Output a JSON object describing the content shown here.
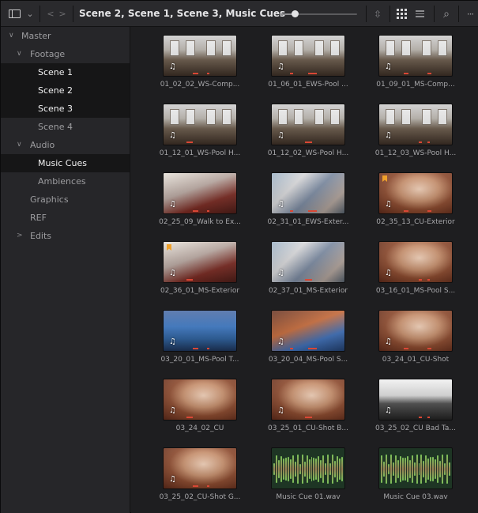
{
  "toolbar": {
    "title": "Scene 2, Scene 1, Scene 3, Music Cues",
    "icons": [
      "sidebar-toggle-icon",
      "chevron-down-icon",
      "back-icon",
      "forward-icon",
      "sort-icon",
      "grid-view-icon",
      "list-view-icon",
      "search-icon",
      "more-options-icon"
    ],
    "zoom_level": 0.19,
    "prev_label": "<",
    "next_label": ">",
    "dropdown_label": "⌄",
    "more_label": "···",
    "search_label": "⌕",
    "sort_label": "⇳"
  },
  "sidebar": {
    "items": [
      {
        "label": "Master",
        "expander": "∨",
        "selected": false
      },
      {
        "label": "Footage",
        "expander": "∨",
        "selected": false
      },
      {
        "label": "Scene 1",
        "expander": "",
        "selected": true
      },
      {
        "label": "Scene 2",
        "expander": "",
        "selected": true
      },
      {
        "label": "Scene 3",
        "expander": "",
        "selected": true
      },
      {
        "label": "Scene 4",
        "expander": "",
        "selected": false
      },
      {
        "label": "Audio",
        "expander": "∨",
        "selected": false
      },
      {
        "label": "Music Cues",
        "expander": "",
        "selected": true
      },
      {
        "label": "Ambiences",
        "expander": "",
        "selected": false
      },
      {
        "label": "Graphics",
        "expander": "",
        "selected": false
      },
      {
        "label": "REF",
        "expander": "",
        "selected": false
      },
      {
        "label": "Edits",
        "expander": ">",
        "selected": false
      }
    ]
  },
  "clips": [
    {
      "name": "01_02_02_WS-Comp...",
      "style": "room",
      "flag": false
    },
    {
      "name": "01_06_01_EWS-Pool ...",
      "style": "room",
      "flag": false
    },
    {
      "name": "01_09_01_MS-Comp...",
      "style": "room",
      "flag": false
    },
    {
      "name": "01_12_01_WS-Pool H...",
      "style": "room",
      "flag": false
    },
    {
      "name": "01_12_02_WS-Pool H...",
      "style": "room",
      "flag": false
    },
    {
      "name": "01_12_03_WS-Pool H...",
      "style": "room",
      "flag": false
    },
    {
      "name": "02_25_09_Walk to Ex...",
      "style": "red",
      "flag": false
    },
    {
      "name": "02_31_01_EWS-Exter...",
      "style": "graffiti",
      "flag": false
    },
    {
      "name": "02_35_13_CU-Exterior",
      "style": "face",
      "flag": true
    },
    {
      "name": "02_36_01_MS-Exterior",
      "style": "red",
      "flag": true
    },
    {
      "name": "02_37_01_MS-Exterior",
      "style": "graffiti",
      "flag": false
    },
    {
      "name": "03_16_01_MS-Pool S...",
      "style": "face",
      "flag": false
    },
    {
      "name": "03_20_01_MS-Pool T...",
      "style": "pool",
      "flag": false
    },
    {
      "name": "03_20_04_MS-Pool S...",
      "style": "pool2",
      "flag": false
    },
    {
      "name": "03_24_01_CU-Shot",
      "style": "face",
      "flag": false
    },
    {
      "name": "03_24_02_CU",
      "style": "face",
      "flag": false
    },
    {
      "name": "03_25_01_CU-Shot B...",
      "style": "face",
      "flag": false
    },
    {
      "name": "03_25_02_CU Bad Ta...",
      "style": "slate",
      "flag": false
    },
    {
      "name": "03_25_02_CU-Shot G...",
      "style": "face",
      "flag": false
    },
    {
      "name": "Music Cue 01.wav",
      "style": "audio",
      "flag": false
    },
    {
      "name": "Music Cue 03.wav",
      "style": "audio",
      "flag": false
    }
  ],
  "audio_badge": "♫"
}
